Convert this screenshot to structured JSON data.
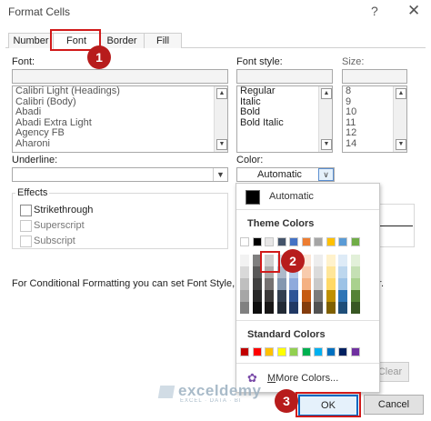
{
  "dialog": {
    "title": "Format Cells",
    "help_glyph": "?",
    "close_glyph": "✕",
    "tabs": [
      {
        "label": "Number"
      },
      {
        "label": "Font"
      },
      {
        "label": "Border"
      },
      {
        "label": "Fill"
      }
    ],
    "active_tab": "Font"
  },
  "font": {
    "label": "Font:",
    "value": "",
    "items": [
      "Calibri Light (Headings)",
      "Calibri (Body)",
      "Abadi",
      "Abadi Extra Light",
      "Agency FB",
      "Aharoni"
    ]
  },
  "font_style": {
    "label": "Font style:",
    "value": "",
    "items": [
      "Regular",
      "Italic",
      "Bold",
      "Bold Italic"
    ]
  },
  "size": {
    "label": "Size:",
    "value": "",
    "items": [
      "8",
      "9",
      "10",
      "11",
      "12",
      "14"
    ]
  },
  "underline": {
    "label": "Underline:",
    "value": ""
  },
  "color": {
    "label": "Color:",
    "value": "Automatic"
  },
  "effects": {
    "label": "Effects",
    "strikethrough": "Strikethrough",
    "superscript": "Superscript",
    "subscript": "Subscript",
    "strikethrough_checked": false
  },
  "info_text": "For Conditional Formatting you can set Font Style, Un",
  "info_tail": "r.",
  "color_picker": {
    "automatic_label": "Automatic",
    "theme_colors_label": "Theme Colors",
    "standard_colors_label": "Standard Colors",
    "more_colors_label": "More Colors...",
    "theme_top_row": [
      "#ffffff",
      "#000000",
      "#e7e6e6",
      "#44546a",
      "#4472c4",
      "#ed7d31",
      "#a5a5a5",
      "#ffc000",
      "#5b9bd5",
      "#70ad47"
    ],
    "theme_shades": [
      [
        "#f2f2f2",
        "#7f7f7f",
        "#d0cece",
        "#d6dce5",
        "#dae3f3",
        "#fbe5d6",
        "#ededed",
        "#fff2cc",
        "#deebf7",
        "#e2f0d9"
      ],
      [
        "#d9d9d9",
        "#595959",
        "#aeabab",
        "#adb9ca",
        "#b4c7e7",
        "#f8cbad",
        "#dbdbdb",
        "#ffe699",
        "#bdd7ee",
        "#c5e0b4"
      ],
      [
        "#bfbfbf",
        "#404040",
        "#757171",
        "#8497b0",
        "#8faadc",
        "#f4b183",
        "#c9c9c9",
        "#ffd966",
        "#9dc3e6",
        "#a9d18e"
      ],
      [
        "#a6a6a6",
        "#262626",
        "#3a3838",
        "#333f50",
        "#2f5597",
        "#c55a11",
        "#7b7b7b",
        "#bf9000",
        "#2e75b6",
        "#548235"
      ],
      [
        "#808080",
        "#0d0d0d",
        "#171616",
        "#222a35",
        "#203864",
        "#843c0c",
        "#525252",
        "#7f6000",
        "#1f4e79",
        "#385723"
      ]
    ],
    "standard": [
      "#c00000",
      "#ff0000",
      "#ffc000",
      "#ffff00",
      "#92d050",
      "#00b050",
      "#00b0f0",
      "#0070c0",
      "#002060",
      "#7030a0"
    ]
  },
  "preview_clear": "Clear",
  "buttons": {
    "ok": "OK",
    "cancel": "Cancel"
  },
  "annotations": {
    "badge1": "1",
    "badge2": "2",
    "badge3": "3",
    "highlight_color": "#d11a1a"
  },
  "watermark": {
    "name": "exceldemy",
    "tagline": "EXCEL · DATA · BI"
  }
}
